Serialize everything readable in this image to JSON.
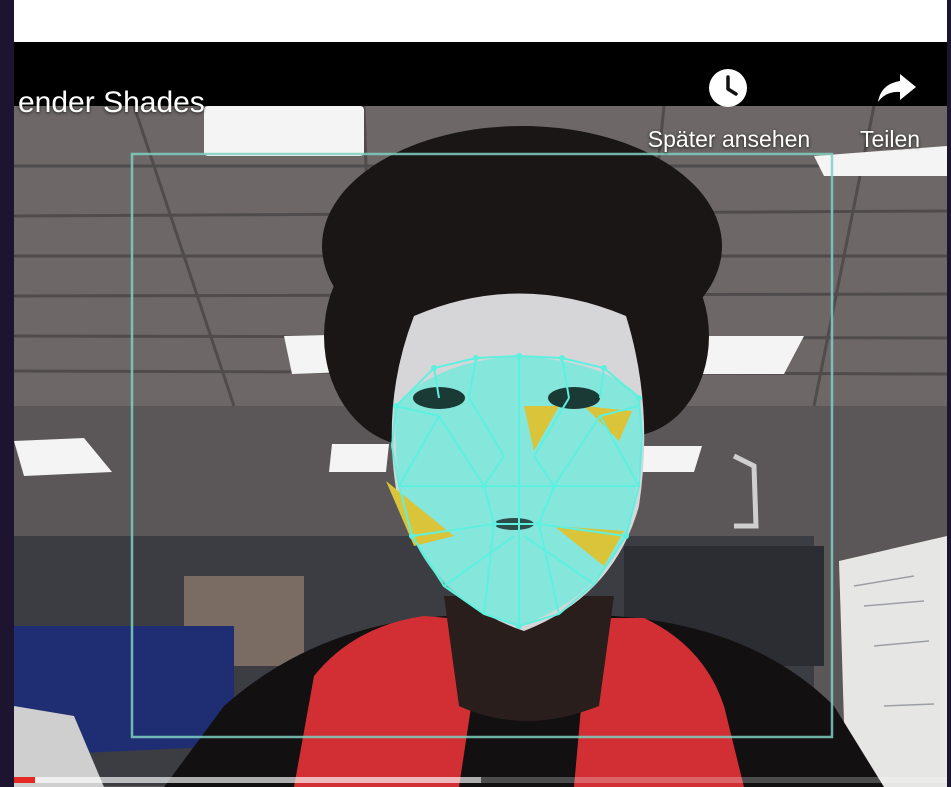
{
  "video": {
    "title": "ender Shades",
    "actions": {
      "watch_later": {
        "label": "Später ansehen",
        "icon": "clock-icon"
      },
      "share": {
        "label": "Teilen",
        "icon": "share-arrow-icon"
      }
    },
    "progress": {
      "played_fraction": 0.023,
      "buffered_fraction": 0.5
    }
  },
  "colors": {
    "mesh": "#5ef0de",
    "mesh_fill": "#7ce8dc",
    "highlight": "#d9c43a",
    "shirt": "#d12f34",
    "progress_played": "#e52822"
  }
}
